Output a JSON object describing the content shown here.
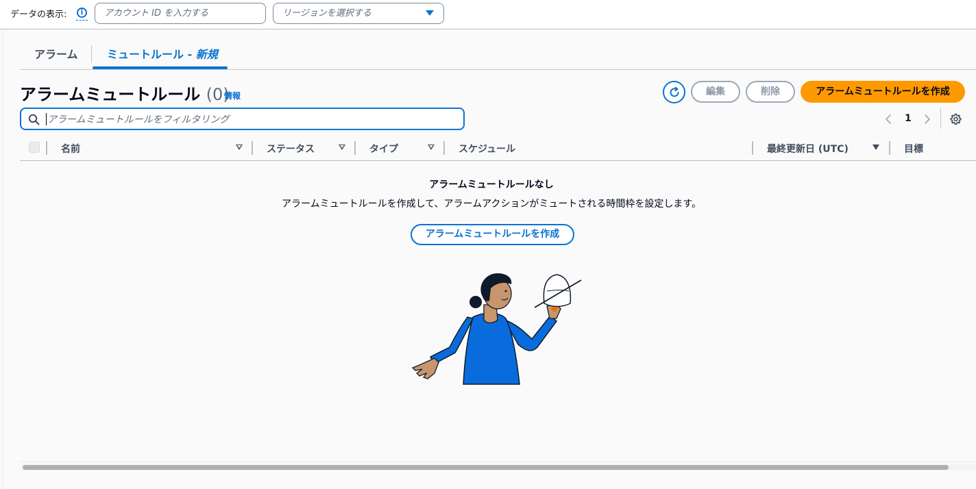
{
  "topbar": {
    "view_label": "データの表示:",
    "account_placeholder": "アカウント ID を入力する",
    "region_placeholder": "リージョンを選択する"
  },
  "tabs": [
    {
      "label": "アラーム"
    },
    {
      "label_main": "ミュートルール - ",
      "label_new": "新規"
    }
  ],
  "header": {
    "title": "アラームミュートルール",
    "count": "(0)",
    "info": "情報",
    "edit_label": "編集",
    "delete_label": "削除",
    "create_label": "アラームミュートルールを作成"
  },
  "filter": {
    "placeholder": "アラームミュートルールをフィルタリング"
  },
  "pagination": {
    "current_page": "1"
  },
  "table": {
    "columns": [
      "名前",
      "ステータス",
      "タイプ",
      "スケジュール",
      "最終更新日 (UTC)",
      "目標"
    ]
  },
  "empty_state": {
    "title": "アラームミュートルールなし",
    "description": "アラームミュートルールを作成して、アラームアクションがミュートされる時間枠を設定します。",
    "button_label": "アラームミュートルールを作成"
  },
  "colors": {
    "accent": "#0972d3",
    "primary_button": "#ff9900",
    "illustration_shirt": "#0a6cdc",
    "illustration_skin": "#c8956d",
    "illustration_hair": "#0f1b2a"
  }
}
